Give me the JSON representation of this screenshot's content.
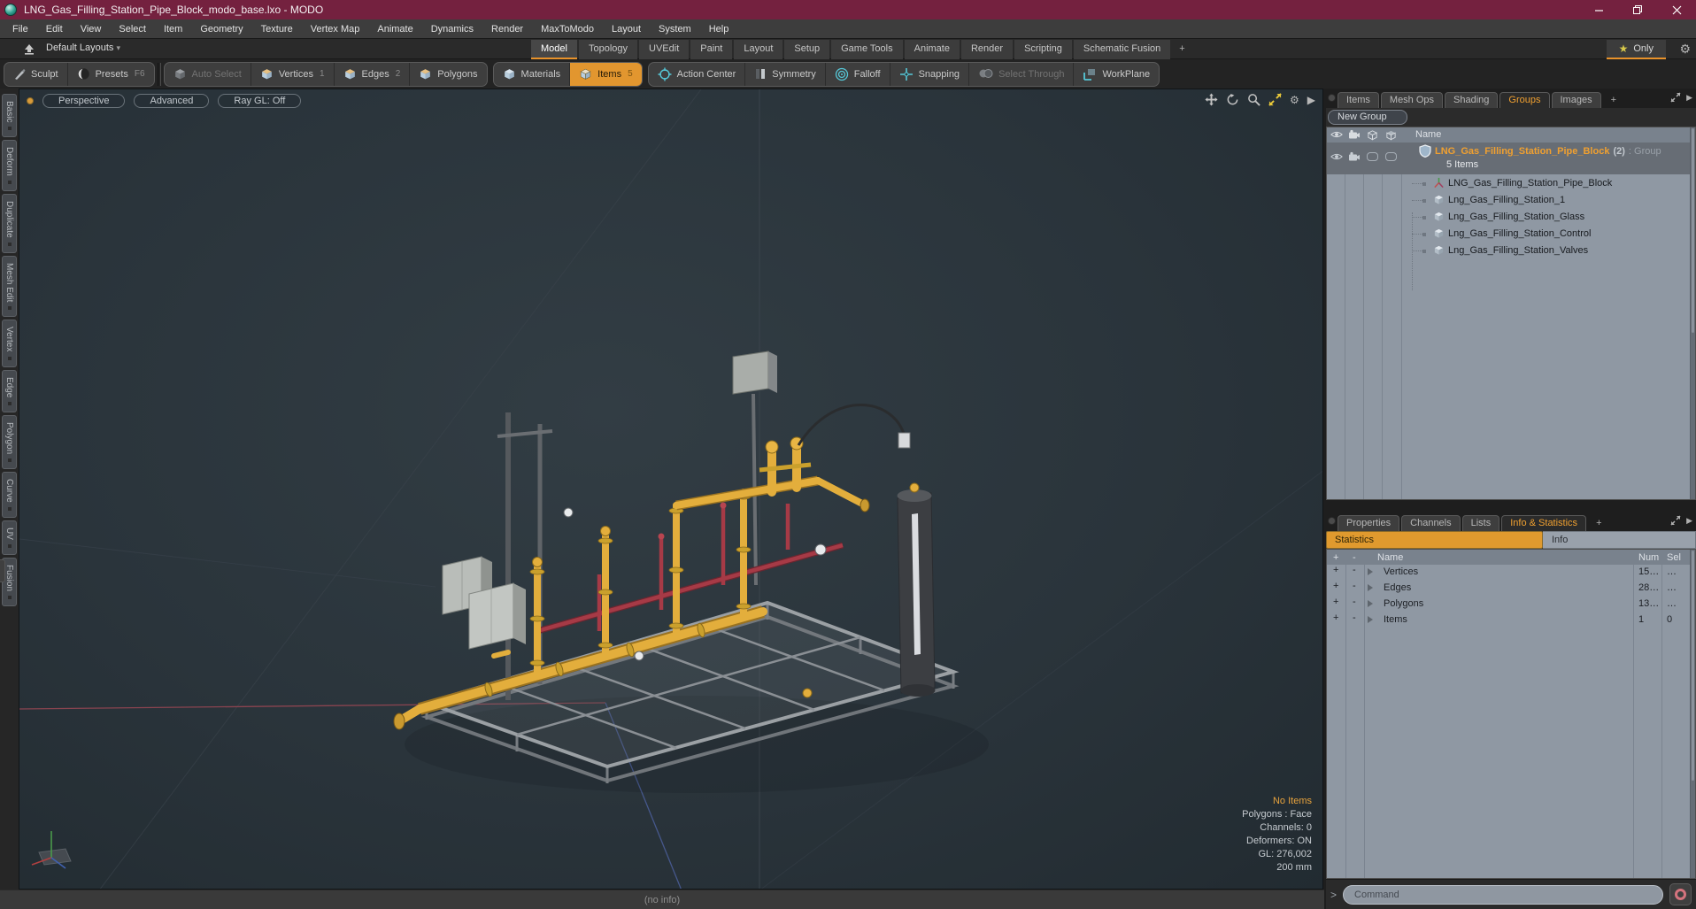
{
  "window": {
    "title": "LNG_Gas_Filling_Station_Pipe_Block_modo_base.lxo - MODO"
  },
  "menu": {
    "items": [
      "File",
      "Edit",
      "View",
      "Select",
      "Item",
      "Geometry",
      "Texture",
      "Vertex Map",
      "Animate",
      "Dynamics",
      "Render",
      "MaxToModo",
      "Layout",
      "System",
      "Help"
    ]
  },
  "layout_bar": {
    "preset_label": "Default Layouts",
    "tabs": [
      "Model",
      "Topology",
      "UVEdit",
      "Paint",
      "Layout",
      "Setup",
      "Game Tools",
      "Animate",
      "Render",
      "Scripting",
      "Schematic Fusion",
      "+"
    ],
    "active_tab": "Model",
    "only_label": "Only"
  },
  "toolbar": {
    "sculpt": "Sculpt",
    "presets": "Presets",
    "presets_key": "F6",
    "auto_select": "Auto Select",
    "vertices": "Vertices",
    "vertices_count": "1",
    "edges": "Edges",
    "edges_count": "2",
    "polygons": "Polygons",
    "materials": "Materials",
    "items": "Items",
    "items_count": "5",
    "action_center": "Action Center",
    "symmetry": "Symmetry",
    "falloff": "Falloff",
    "snapping": "Snapping",
    "select_through": "Select Through",
    "workplane": "WorkPlane"
  },
  "left_tabs": {
    "items": [
      "Basic",
      "Deform",
      "Duplicate",
      "Mesh Edit",
      "Vertex",
      "Edge",
      "Polygon",
      "Curve",
      "UV",
      "Fusion"
    ]
  },
  "viewport": {
    "mode": "Perspective",
    "shading": "Advanced",
    "raygl": "Ray GL: Off",
    "info_highlight": "No Items",
    "info_lines": [
      "Polygons : Face",
      "Channels: 0",
      "Deformers: ON",
      "GL: 276,002",
      "200 mm"
    ]
  },
  "groups_panel": {
    "tabs": [
      "Items",
      "Mesh Ops",
      "Shading",
      "Groups",
      "Images",
      "+"
    ],
    "active_tab": "Groups",
    "new_group_label": "New Group",
    "name_header": "Name",
    "group": {
      "name": "LNG_Gas_Filling_Station_Pipe_Block",
      "count": "(2)",
      "type": ": Group",
      "subtitle": "5 Items"
    },
    "children": [
      "LNG_Gas_Filling_Station_Pipe_Block",
      "Lng_Gas_Filling_Station_1",
      "Lng_Gas_Filling_Station_Glass",
      "Lng_Gas_Filling_Station_Control",
      "Lng_Gas_Filling_Station_Valves"
    ]
  },
  "stats_panel": {
    "tabs": [
      "Properties",
      "Channels",
      "Lists",
      "Info & Statistics",
      "+"
    ],
    "active_tab": "Info & Statistics",
    "subtab_statistics": "Statistics",
    "subtab_info": "Info",
    "headers": {
      "plus": "+",
      "minus": "-",
      "name": "Name",
      "num": "Num",
      "sel": "Sel"
    },
    "controls": {
      "expand": "+",
      "collapse": "-"
    },
    "rows": [
      {
        "name": "Vertices",
        "num": "15…",
        "sel": "…"
      },
      {
        "name": "Edges",
        "num": "28…",
        "sel": "…"
      },
      {
        "name": "Polygons",
        "num": "13…",
        "sel": "…"
      },
      {
        "name": "Items",
        "num": "1",
        "sel": "0"
      }
    ]
  },
  "command_bar": {
    "prompt": ">",
    "placeholder": "Command"
  },
  "status_bar": {
    "text": "(no info)"
  }
}
